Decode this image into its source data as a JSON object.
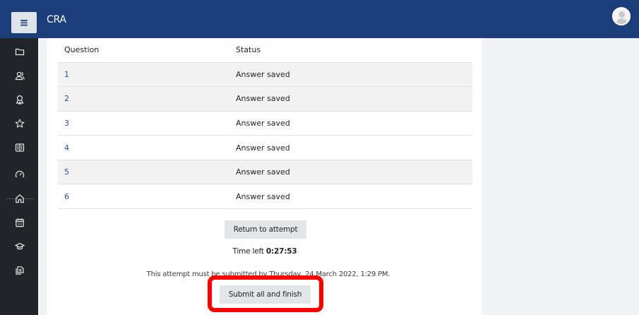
{
  "header": {
    "menu_icon": "hamburger-icon",
    "site_name": "CRA",
    "avatar_icon": "user-avatar"
  },
  "sidebar": {
    "items": [
      {
        "icon": "folder-icon"
      },
      {
        "icon": "participants-icon"
      },
      {
        "icon": "badge-icon"
      },
      {
        "icon": "star-icon"
      },
      {
        "icon": "book-icon"
      },
      {
        "icon": "dashboard-icon"
      },
      {
        "icon": "home-icon"
      },
      {
        "icon": "calendar-icon"
      },
      {
        "icon": "graduation-cap-icon"
      },
      {
        "icon": "files-icon"
      }
    ]
  },
  "summary": {
    "headers": {
      "question": "Question",
      "status": "Status"
    },
    "rows": [
      {
        "question": "1",
        "status": "Answer saved"
      },
      {
        "question": "2",
        "status": "Answer saved"
      },
      {
        "question": "3",
        "status": "Answer saved"
      },
      {
        "question": "4",
        "status": "Answer saved"
      },
      {
        "question": "5",
        "status": "Answer saved"
      },
      {
        "question": "6",
        "status": "Answer saved"
      }
    ]
  },
  "actions": {
    "return_label": "Return to attempt",
    "time_left_label": "Time left",
    "time_left_value": "0:27:53",
    "deadline_text": "This attempt must be submitted by Thursday, 24 March 2022, 1:29 PM.",
    "submit_label": "Submit all and finish"
  },
  "colors": {
    "header": "#1b3d7a",
    "sidebar": "#212529",
    "link": "#2b4e94",
    "highlight": "#ff0000"
  }
}
